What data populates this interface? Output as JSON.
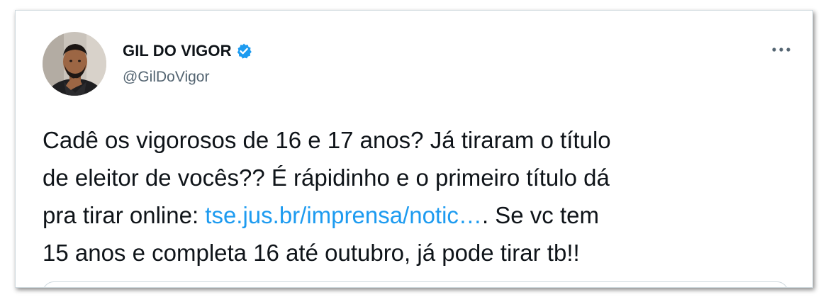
{
  "tweet": {
    "author": {
      "display_name": "GIL DO VIGOR",
      "handle": "@GilDoVigor",
      "verified": true,
      "avatar_icon": "profile-photo"
    },
    "more_icon": "ellipsis-icon",
    "text": {
      "line1": "Cadê os vigorosos de 16 e 17 anos? Já tiraram o título",
      "line2": "de eleitor de vocês?? É rápidinho e o primeiro título dá",
      "line3_prefix": "pra tirar online: ",
      "link": "tse.jus.br/imprensa/notic…",
      "line3_suffix": ". Se vc tem",
      "line4": "15 anos e completa 16 até outubro, já pode tirar tb!!"
    }
  },
  "colors": {
    "text": "#0f1419",
    "secondary": "#536471",
    "link": "#1d9bf0",
    "verified_badge": "#1d9bf0",
    "border": "#cfd9de"
  }
}
